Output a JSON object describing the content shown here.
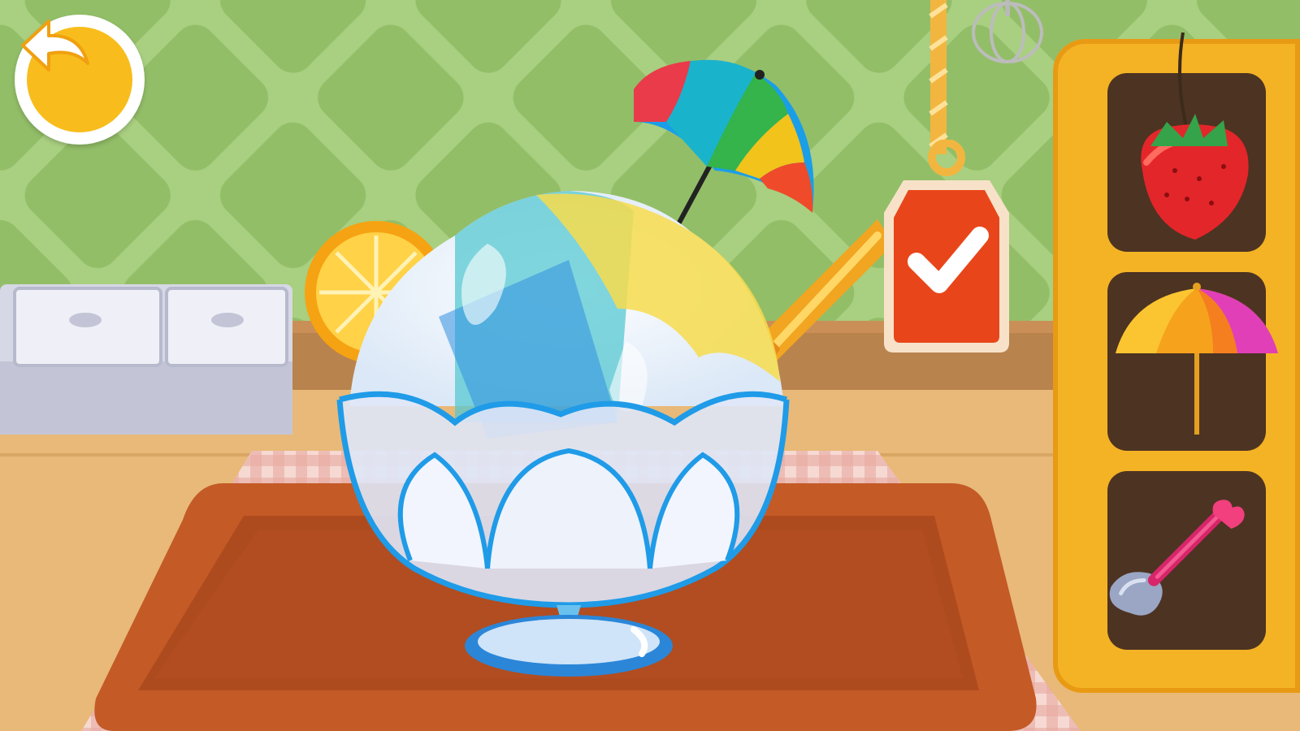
{
  "scene": {
    "background_color": "#a9cf80",
    "tile_color": "#93be68",
    "counter_color": "#e8b978",
    "tray_color": "#c45a26"
  },
  "controls": {
    "back_icon": "back-arrow-icon",
    "confirm_icon": "checkmark-icon"
  },
  "toppings_shelf": {
    "items": [
      {
        "icon": "strawberry-icon"
      },
      {
        "icon": "umbrella-icon"
      },
      {
        "icon": "scoop-spoon-icon"
      }
    ]
  }
}
